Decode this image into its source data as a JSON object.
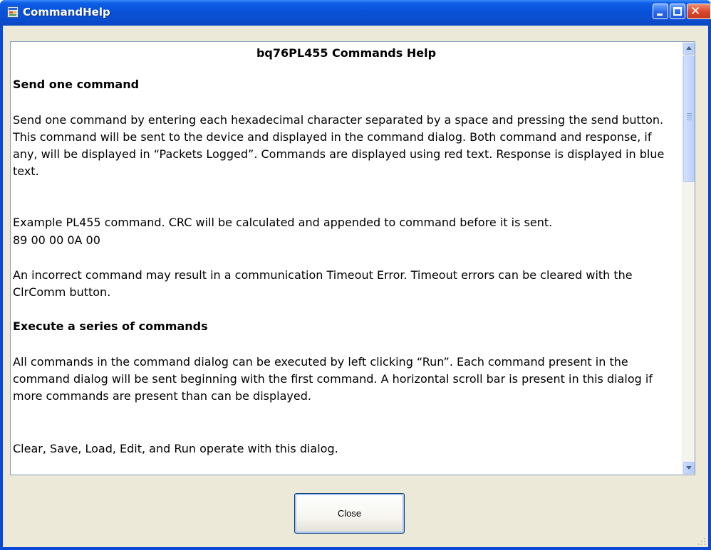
{
  "window": {
    "title": "CommandHelp"
  },
  "document": {
    "heading": "bq76PL455 Commands Help",
    "sections": [
      {
        "kind": "heading",
        "text": "Send one command"
      },
      {
        "kind": "para",
        "text": "Send one command by entering each hexadecimal character separated by a space and pressing the send button.   This command will be sent to the device and displayed in the command dialog.  Both command and response, if any, will be displayed in “Packets Logged”.   Commands are displayed using red text.  Response is displayed in blue text."
      },
      {
        "kind": "para",
        "text": "Example PL455 command.  CRC will be calculated and appended to command before it is sent."
      },
      {
        "kind": "code",
        "text": "89 00 00 0A 00"
      },
      {
        "kind": "para",
        "text": "An incorrect command may result in a communication Timeout Error.   Timeout errors can be cleared with the ClrComm button."
      },
      {
        "kind": "heading",
        "text": "Execute a series of commands"
      },
      {
        "kind": "para",
        "text": "All commands in the command dialog can be executed by left clicking “Run”.  Each command present in the command dialog will be sent beginning with the first command.   A horizontal scroll bar is present in this dialog if more commands are present than can be displayed."
      },
      {
        "kind": "para",
        "text": "Clear, Save, Load, Edit, and Run operate with this dialog."
      }
    ]
  },
  "buttons": {
    "close_label": "Close"
  },
  "icons": {
    "app": "app-window-icon",
    "minimize": "minimize-icon",
    "maximize": "maximize-icon",
    "close": "close-icon",
    "scroll_up": "chevron-up-icon",
    "scroll_down": "chevron-down-icon"
  },
  "colors": {
    "titlebar": "#0852d8",
    "client_bg": "#ece9d8",
    "close_window_button": "#d9452b"
  }
}
